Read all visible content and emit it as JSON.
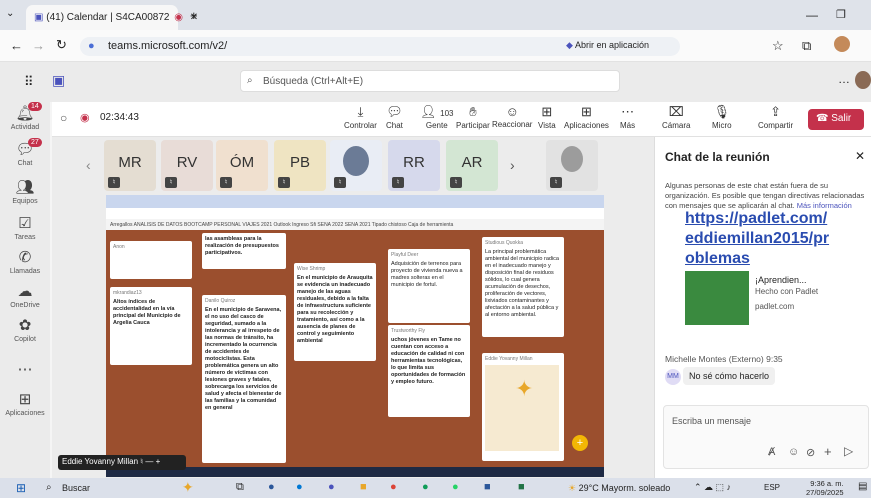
{
  "browser": {
    "tab_title": "(41) Calendar | S4CA00872",
    "address": "teams.microsoft.com/v2/",
    "open_in_app": "Abrir en aplicación"
  },
  "teams": {
    "search_placeholder": "Búsqueda (Ctrl+Alt+E)"
  },
  "rail": {
    "items": [
      {
        "label": "Actividad",
        "badge": "14"
      },
      {
        "label": "Chat",
        "badge": "27"
      },
      {
        "label": "Equipos"
      },
      {
        "label": "Tareas"
      },
      {
        "label": "Llamadas"
      },
      {
        "label": "OneDrive"
      },
      {
        "label": "Copilot"
      },
      {
        "label": "Aplicaciones"
      }
    ]
  },
  "meeting": {
    "timer": "02:34:43",
    "participants_count": "103",
    "toolbar": {
      "controlar": "Controlar",
      "chat": "Chat",
      "gente": "Gente",
      "participar": "Participar",
      "reaccionar": "Reaccionar",
      "vista": "Vista",
      "aplicaciones": "Aplicaciones",
      "mas": "Más",
      "camara": "Cámara",
      "micro": "Micro",
      "compartir": "Compartir",
      "salir": "Salir"
    },
    "thumbs": [
      {
        "initials": "MR",
        "color": "#e4ddd2"
      },
      {
        "initials": "RV",
        "color": "#e8dcd7"
      },
      {
        "initials": "ÓM",
        "color": "#f0e0cf"
      },
      {
        "initials": "PB",
        "color": "#efe4c2"
      },
      {
        "initials": "",
        "color": "#6b7b96"
      },
      {
        "initials": "RR",
        "color": "#d6d9ec"
      },
      {
        "initials": "AR",
        "color": "#d3e6d3"
      },
      {
        "initials": "",
        "color": "#9c9c9c"
      }
    ],
    "presenter": "Eddie Yovanny Millan"
  },
  "shared": {
    "bookmarks": "Arregallos  ANALISIS DE DATOS  BOOTCAMP  PERSONAL  VIAJES 2021  Outlook  Ingreso Sfi  SENA 2022  SENA 2021  Tipado chistoso  Caja de herramienta",
    "col1": {
      "c1": {
        "author": "Anon",
        "text": ""
      },
      "c2": {
        "author": "mkrandiaz13",
        "text": "Altos índices de accidentalidad en la vía principal del Municipio de Argelia Cauca"
      }
    },
    "col2": {
      "c1": {
        "text": "las asambleas para la realización de presupuestos participativos."
      },
      "c2": {
        "author": "Danilo Quiroz",
        "text": "En el municipio de Saravena, el no uso del casco de seguridad, sumado a la intolerancia y al irrespeto de las normas de tránsito, ha incrementado la ocurrencia de accidentes de motociclistas. Esta problemática genera un alto número de víctimas con lesiones graves y fatales, sobrecarga los servicios de salud y afecta el bienestar de las familias y la comunidad en general"
      }
    },
    "col3": {
      "c1": {
        "author": "Wise Shrimp",
        "text": "En el municipio de Arauquita se evidencia un inadecuado manejo de las aguas residuales, debido a la falta de infraestructura suficiente para su recolección y tratamiento, así como a la ausencia de planes de control y seguimiento ambiental"
      }
    },
    "col4": {
      "c1": {
        "author": "Playful Deer",
        "text": "Adquisición de terrenos para proyecto de vivienda nueva a madres solteras en el municipio de fortul."
      },
      "c2": {
        "author": "Trustworthy Fly",
        "text": "uchos jóvenes en Tame no cuentan con acceso a educación de calidad ni con herramientas tecnológicas, lo que limita sus oportunidades de formación y empleo futuro."
      }
    },
    "col5": {
      "c1": {
        "author": "Studious Quokka",
        "text": "La principal problemática ambiental del municipio radica en el inadecuado manejo y disposición final de residuos sólidos, lo cual genera acumulación de desechos, proliferación de vectores, lixiviados contaminantes y afectación a la salud pública y al entorno ambiental."
      },
      "c2": {
        "author": "Eddie Yovanny Millan",
        "text": ""
      }
    }
  },
  "chat": {
    "title": "Chat de la reunión",
    "notice": "Algunas personas de este chat están fuera de su organización. Es posible que tengan directivas relacionadas con mensajes que se aplicarán al chat.",
    "more_info": "Más información",
    "link_line1": "https://padlet.com/",
    "link_line2": "eddiemillan2015/pr",
    "link_line3": "oblemas",
    "preview_title": "¡Aprendien...",
    "preview_sub": "Hecho con Padlet",
    "preview_domain": "padlet.com",
    "sender": "Michelle Montes (Externo)",
    "time": "9:35",
    "avatar": "MM",
    "message": "No sé cómo hacerlo",
    "compose_placeholder": "Escriba un mensaje"
  },
  "taskbar": {
    "search": "Buscar",
    "weather": "29°C  Mayorm. soleado",
    "lang": "ESP",
    "clock_time": "9:36 a. m.",
    "clock_date": "27/09/2025"
  }
}
